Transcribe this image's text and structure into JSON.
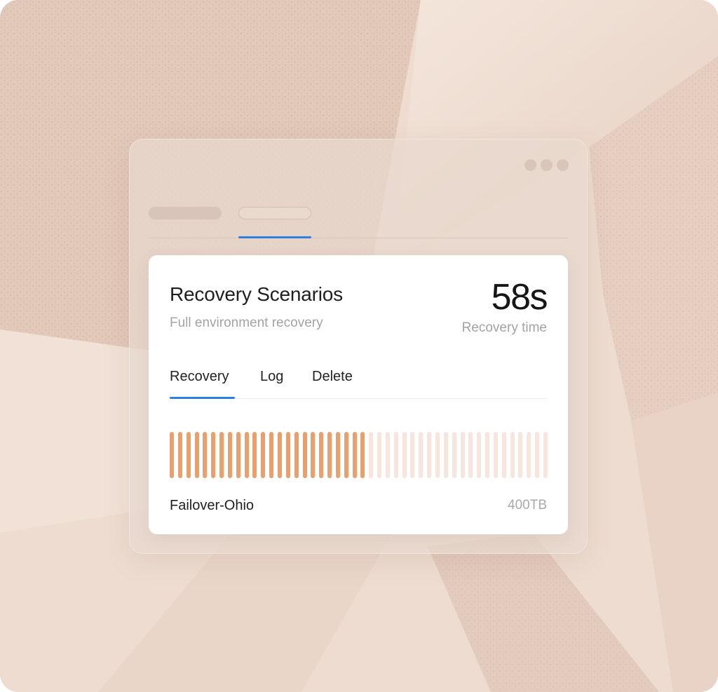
{
  "card": {
    "title": "Recovery Scenarios",
    "subtitle": "Full environment recovery",
    "metric_value": "58s",
    "metric_label": "Recovery time"
  },
  "tabs": [
    {
      "label": "Recovery",
      "active": true
    },
    {
      "label": "Log",
      "active": false
    },
    {
      "label": "Delete",
      "active": false
    }
  ],
  "progress": {
    "total_segments": 46,
    "filled_segments": 24,
    "fraction": 0.52,
    "filled_color": "#e9a06c",
    "empty_color": "#f8e6de"
  },
  "footer": {
    "name": "Failover-Ohio",
    "size": "400TB"
  },
  "colors": {
    "background": "#ecd9cc",
    "accent": "#2f7fe0",
    "card": "#ffffff"
  }
}
